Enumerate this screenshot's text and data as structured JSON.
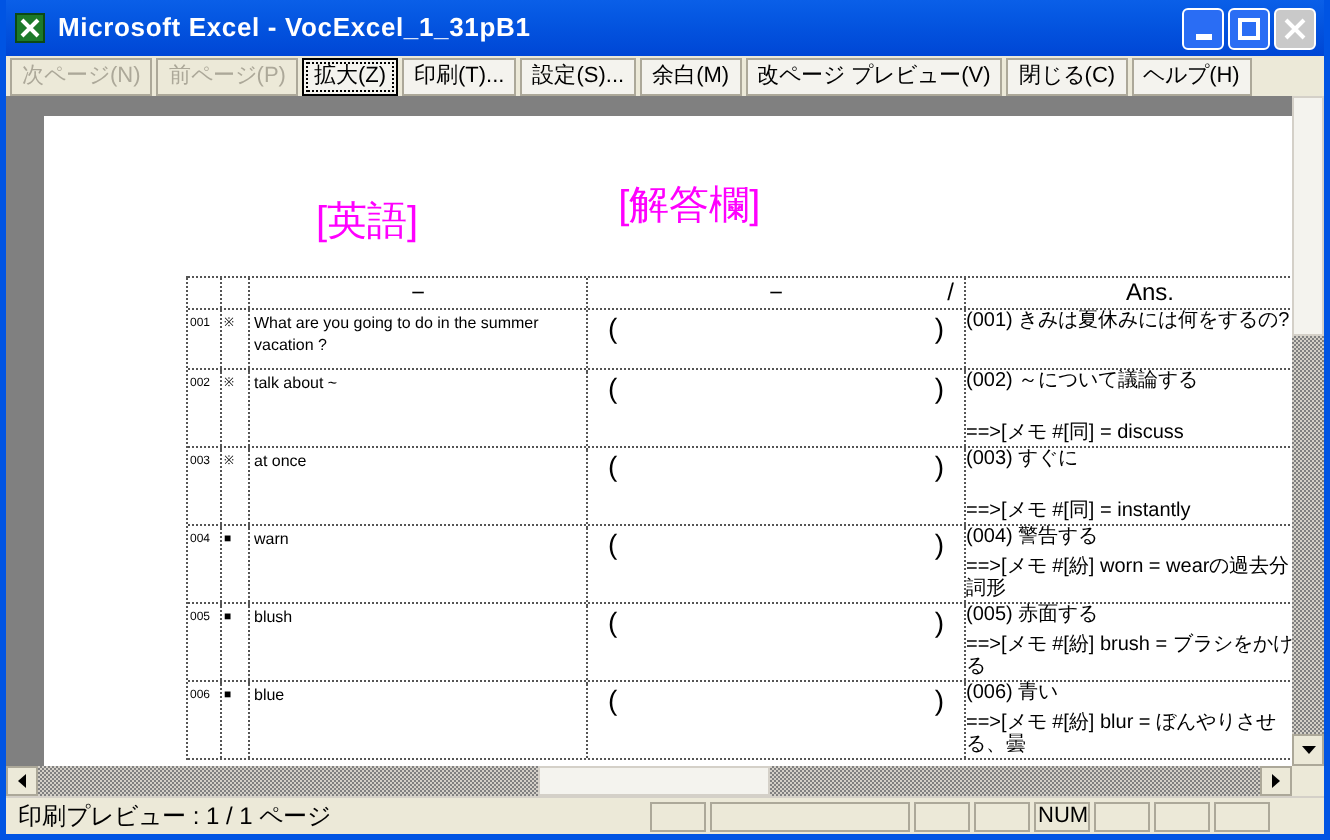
{
  "window": {
    "title": "Microsoft Excel - VocExcel_1_31pB1"
  },
  "toolbar": [
    {
      "label": "次ページ(N)",
      "disabled": true,
      "selected": false
    },
    {
      "label": "前ページ(P)",
      "disabled": true,
      "selected": false
    },
    {
      "label": "拡大(Z)",
      "disabled": false,
      "selected": true
    },
    {
      "label": "印刷(T)...",
      "disabled": false,
      "selected": false
    },
    {
      "label": "設定(S)...",
      "disabled": false,
      "selected": false
    },
    {
      "label": "余白(M)",
      "disabled": false,
      "selected": false
    },
    {
      "label": "改ページ プレビュー(V)",
      "disabled": false,
      "selected": false
    },
    {
      "label": "閉じる(C)",
      "disabled": false,
      "selected": false
    },
    {
      "label": "ヘルプ(H)",
      "disabled": false,
      "selected": false
    }
  ],
  "page": {
    "heading_english": "[英語]",
    "heading_answer": "[解答欄]",
    "table": {
      "header": {
        "column_3": "－",
        "column_4": "－",
        "column_4_mark": "/",
        "column_5": "Ans."
      },
      "rows": [
        {
          "number": "001",
          "mark": "※",
          "english": "What are  you going to  do  in the summer vacation ?",
          "open": "(",
          "close": ")",
          "answer": [
            "(001)  きみは夏休みには何をするの?"
          ]
        },
        {
          "number": "002",
          "mark": "※",
          "english": "talk about ~",
          "open": "(",
          "close": ")",
          "answer": [
            "(002)  ～について議論する",
            "==>[メモ  #[同] = discuss"
          ]
        },
        {
          "number": "003",
          "mark": "※",
          "english": "at once",
          "open": "(",
          "close": ")",
          "answer": [
            "(003)  すぐに",
            "==>[メモ  #[同] = instantly"
          ]
        },
        {
          "number": "004",
          "mark": "■",
          "english": "warn",
          "open": "(",
          "close": ")",
          "answer": [
            "(004)  警告する",
            "==>[メモ  #[紛] worn = wearの過去分詞形"
          ]
        },
        {
          "number": "005",
          "mark": "■",
          "english": "blush",
          "open": "(",
          "close": ")",
          "answer": [
            "(005)  赤面する",
            "==>[メモ  #[紛] brush = ブラシをかける"
          ]
        },
        {
          "number": "006",
          "mark": "■",
          "english": "blue",
          "open": "(",
          "close": ")",
          "answer": [
            "(006)  青い",
            "==>[メモ  #[紛] blur = ぼんやりさせる、曇"
          ]
        }
      ]
    }
  },
  "status_bar": {
    "text": "印刷プレビュー : 1 / 1 ページ",
    "indicator": "NUM"
  }
}
